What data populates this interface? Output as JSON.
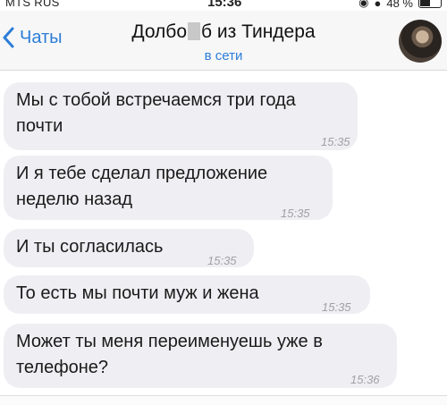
{
  "status_bar": {
    "carrier": "MTS RUS",
    "time": "15:36",
    "battery": "48 %"
  },
  "header": {
    "back_label": "Чаты",
    "title_start": "Долбо",
    "title_end": "б из Тиндера",
    "subtitle": "в сети"
  },
  "messages": [
    {
      "text": "Мы с тобой встречаемся три года почти",
      "time": "15:35"
    },
    {
      "text": "И я тебе сделал предложение неделю назад",
      "time": "15:35"
    },
    {
      "text": "И ты согласилась",
      "time": "15:35"
    },
    {
      "text": "То есть мы почти муж и жена",
      "time": "15:35"
    },
    {
      "text": "Может ты меня переименуешь уже в телефоне?",
      "time": "15:36"
    }
  ]
}
